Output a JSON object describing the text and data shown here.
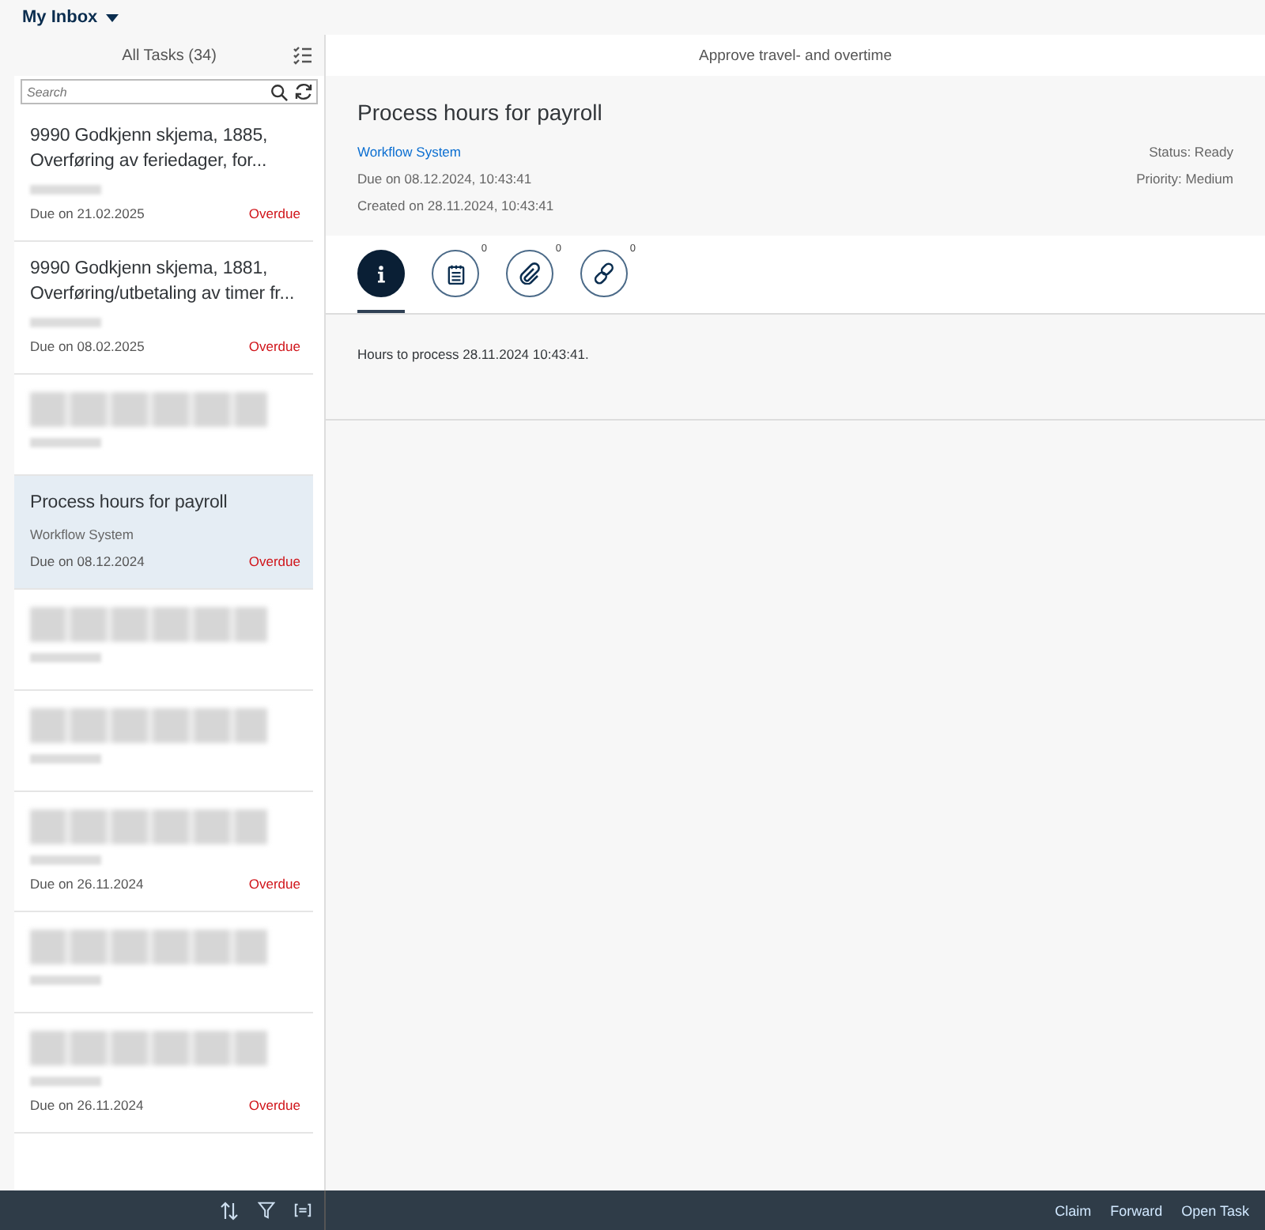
{
  "header": {
    "title": "My Inbox"
  },
  "list": {
    "title": "All Tasks (34)",
    "search": {
      "placeholder": "Search"
    },
    "items": [
      {
        "kind": "task",
        "title": "9990 Godkjenn skjema, 1885, Overføring av feriedager, for...",
        "due": "Due on 21.02.2025",
        "status": "Overdue",
        "selected": false
      },
      {
        "kind": "task",
        "title": "9990 Godkjenn skjema, 1881, Overføring/utbetaling av timer fr...",
        "due": "Due on 08.02.2025",
        "status": "Overdue",
        "selected": false
      },
      {
        "kind": "redacted",
        "selected": false
      },
      {
        "kind": "task",
        "title": "Process hours for payroll",
        "subtitle": "Workflow System",
        "due": "Due on 08.12.2024",
        "status": "Overdue",
        "selected": true
      },
      {
        "kind": "redacted",
        "selected": false
      },
      {
        "kind": "redacted",
        "selected": false
      },
      {
        "kind": "redacted",
        "due": "Due on 26.11.2024",
        "status": "Overdue",
        "selected": false
      },
      {
        "kind": "redacted",
        "selected": false
      },
      {
        "kind": "redacted",
        "due": "Due on 26.11.2024",
        "status": "Overdue",
        "selected": false
      }
    ]
  },
  "detail": {
    "group_title": "Approve travel- and overtime",
    "title": "Process hours for payroll",
    "created_by": "Workflow System",
    "due": "Due on 08.12.2024, 10:43:41",
    "created": "Created on 28.11.2024, 10:43:41",
    "status": "Status: Ready",
    "priority": "Priority: Medium",
    "tabs": [
      {
        "kind": "info",
        "selected": true
      },
      {
        "kind": "notes",
        "count": "0",
        "selected": false
      },
      {
        "kind": "attachments",
        "count": "0",
        "selected": false
      },
      {
        "kind": "links",
        "count": "0",
        "selected": false
      }
    ],
    "description": "Hours to process 28.11.2024 10:43:41."
  },
  "actions": [
    "Claim",
    "Forward",
    "Open Task"
  ]
}
